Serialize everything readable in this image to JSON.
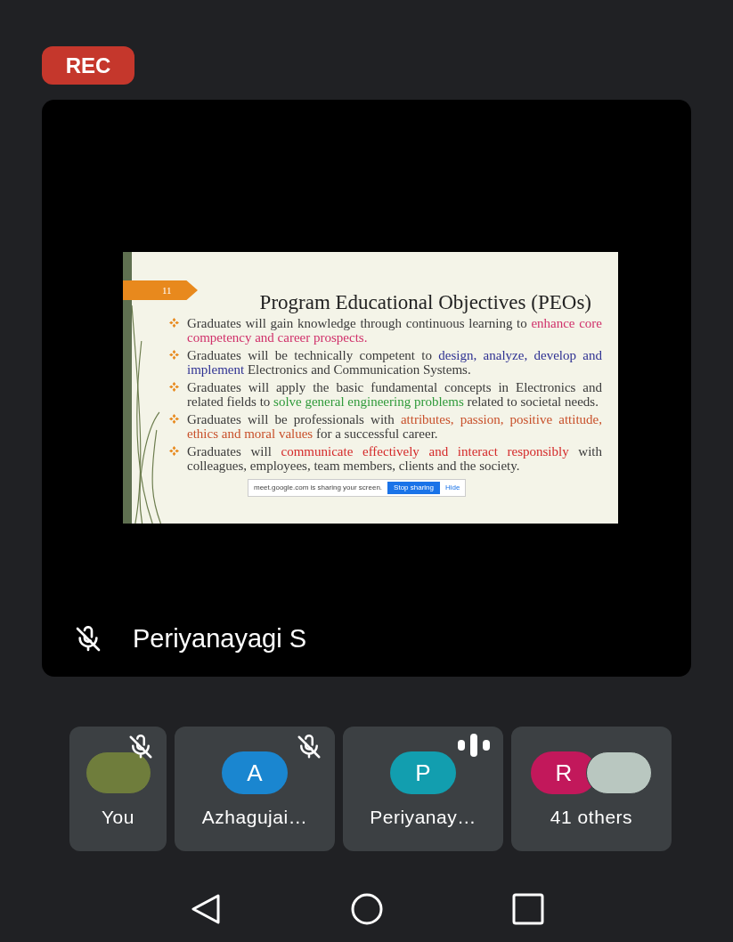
{
  "recording_badge": "REC",
  "main_tile": {
    "speaker": "Periyanayagi S",
    "muted": true,
    "slide": {
      "number": "11",
      "title": "Program Educational Objectives (PEOs)",
      "bullets": [
        {
          "segments": [
            {
              "text": "Graduates will gain knowledge through continuous learning to ",
              "color": "#3a3a3a"
            },
            {
              "text": "enhance core competency and career prospects.",
              "color": "#d0306a"
            }
          ]
        },
        {
          "segments": [
            {
              "text": "Graduates will be technically competent to ",
              "color": "#3a3a3a"
            },
            {
              "text": "design, analyze, develop and implement",
              "color": "#2e3192"
            },
            {
              "text": " Electronics and Communication Systems.",
              "color": "#3a3a3a"
            }
          ]
        },
        {
          "segments": [
            {
              "text": "Graduates will apply the basic fundamental concepts in Electronics and related fields to ",
              "color": "#3a3a3a"
            },
            {
              "text": "solve general engineering problems",
              "color": "#2f9a3a"
            },
            {
              "text": " related to societal needs.",
              "color": "#3a3a3a"
            }
          ]
        },
        {
          "segments": [
            {
              "text": "Graduates will be professionals with ",
              "color": "#3a3a3a"
            },
            {
              "text": "attributes, passion, positive attitude, ethics and moral values",
              "color": "#c8502a"
            },
            {
              "text": " for a successful career.",
              "color": "#3a3a3a"
            }
          ]
        },
        {
          "segments": [
            {
              "text": "Graduates will ",
              "color": "#3a3a3a"
            },
            {
              "text": "communicate effectively and interact responsibly",
              "color": "#d42a2a"
            },
            {
              "text": " with colleagues, employees, team members, clients and the society.",
              "color": "#3a3a3a"
            }
          ]
        }
      ],
      "share_bar": {
        "message": "meet.google.com is sharing your screen.",
        "stop_button": "Stop sharing",
        "hide_button": "Hide"
      }
    }
  },
  "participants": [
    {
      "label": "You",
      "muted": true,
      "speaking": false,
      "avatars": [
        {
          "kind": "photo",
          "color": "#6f7d3c"
        }
      ]
    },
    {
      "label": "Azhagujai…",
      "muted": true,
      "speaking": false,
      "avatars": [
        {
          "kind": "letter",
          "letter": "A",
          "color": "#1a86d0"
        }
      ]
    },
    {
      "label": "Periyanay…",
      "muted": false,
      "speaking": true,
      "avatars": [
        {
          "kind": "letter",
          "letter": "P",
          "color": "#129eaf"
        }
      ]
    },
    {
      "label": "41 others",
      "muted": false,
      "speaking": false,
      "avatars": [
        {
          "kind": "letter",
          "letter": "R",
          "color": "#c2185b"
        },
        {
          "kind": "photo",
          "color": "#b9c7c0"
        }
      ]
    }
  ]
}
